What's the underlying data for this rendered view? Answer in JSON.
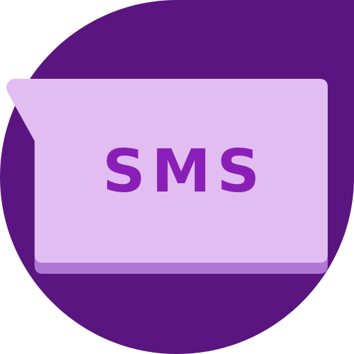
{
  "icon": {
    "name": "sms-chat-bubble-icon",
    "label": "SMS",
    "colors": {
      "background_blob": "#5B1580",
      "bubble_fill": "#E2BDF2",
      "bubble_shadow": "#B076D6",
      "label_text": "#8A1FB8"
    }
  }
}
